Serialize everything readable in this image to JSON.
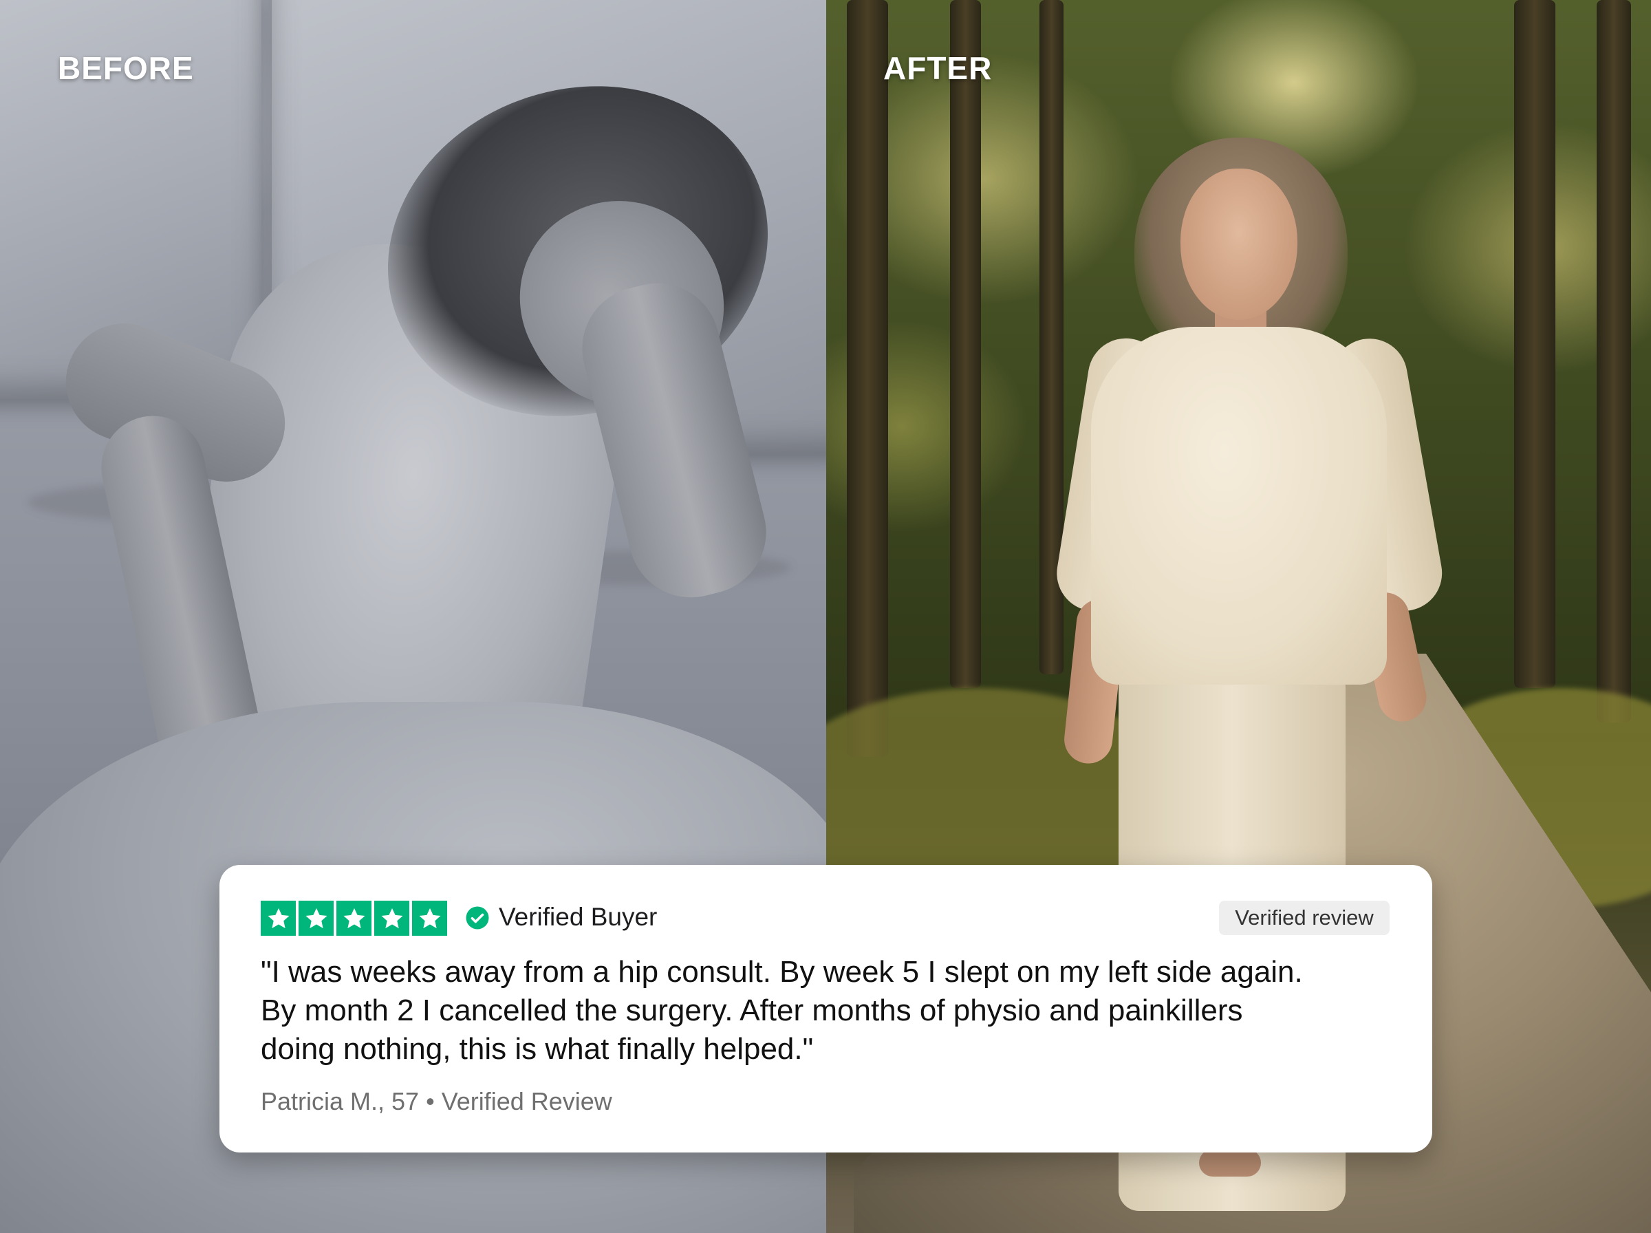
{
  "labels": {
    "before": "BEFORE",
    "after": "AFTER"
  },
  "review": {
    "rating": 5,
    "rating_max": 5,
    "verified_buyer": "Verified Buyer",
    "badge": "Verified review",
    "quote_lines": [
      "\"I was weeks away from a hip consult. By week 5 I slept on my left side again.",
      "By month 2 I cancelled the surgery. After months of physio and painkillers",
      "doing nothing, this is what finally helped.\""
    ],
    "reviewer": "Patricia M., 57 • Verified Review",
    "star_color": "#00b67a",
    "check_color": "#00b67a"
  },
  "icons": {
    "star": "star-icon",
    "verified": "check-circle-icon"
  }
}
